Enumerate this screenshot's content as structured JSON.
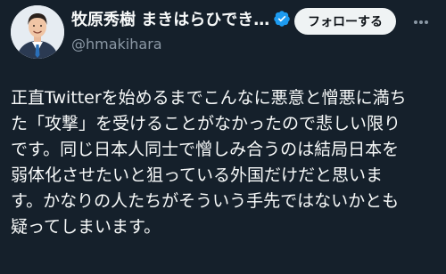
{
  "tweet": {
    "display_name": "牧原秀樹 まきはらひでき…",
    "handle": "@hmakihara",
    "verified_icon": "verified-badge-icon",
    "follow_label": "フォローする",
    "more_icon": "more-dots-icon",
    "body_lines": [
      "正直Twitterを始めるまでこんなに悪意と憎悪に満ち",
      "た「攻撃」を受けることがなかったので悲しい限り",
      "です。同じ日本人同士で憎しみ合うのは結局日本を",
      "弱体化させたいと狙っている外国だけだと思いま",
      "す。かなりの人たちがそういう手先ではないかとも",
      "疑ってしまいます。"
    ]
  },
  "colors": {
    "background": "#15202b",
    "text": "#f7f9f9",
    "secondary_text": "#8b98a5",
    "verified_blue": "#1d9bf0",
    "follow_bg": "#eff3f4"
  }
}
